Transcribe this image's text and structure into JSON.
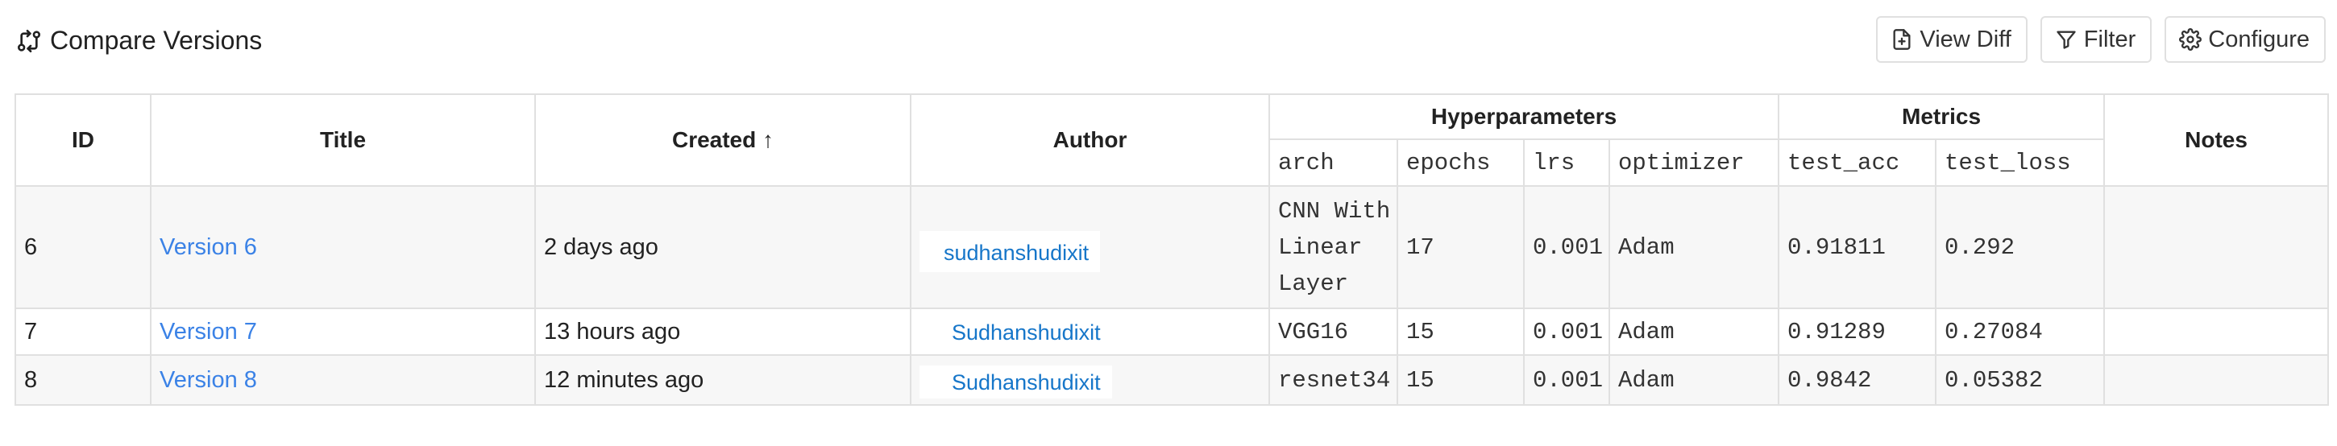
{
  "header": {
    "title": "Compare Versions",
    "title_icon": "compare-icon",
    "actions": {
      "view_diff": "View Diff",
      "filter": "Filter",
      "configure": "Configure"
    }
  },
  "table": {
    "columns": {
      "id": "ID",
      "title": "Title",
      "created": "Created",
      "author": "Author",
      "hyperparameters": "Hyperparameters",
      "metrics": "Metrics",
      "notes": "Notes"
    },
    "sort_indicator": "↑",
    "hyper_columns": [
      "arch",
      "epochs",
      "lrs",
      "optimizer"
    ],
    "metric_columns": [
      "test_acc",
      "test_loss"
    ],
    "rows": [
      {
        "id": "6",
        "title": "Version 6",
        "created": "2 days ago",
        "author": "sudhanshudixit",
        "arch_lines": [
          "CNN With",
          "Linear",
          "Layer"
        ],
        "epochs": "17",
        "lrs": "0.001",
        "optimizer": "Adam",
        "test_acc": "0.91811",
        "test_loss": "0.292",
        "notes": ""
      },
      {
        "id": "7",
        "title": "Version 7",
        "created": "13 hours ago",
        "author": "Sudhanshudixit",
        "arch_lines": [
          "VGG16"
        ],
        "epochs": "15",
        "lrs": "0.001",
        "optimizer": "Adam",
        "test_acc": "0.91289",
        "test_loss": "0.27084",
        "notes": ""
      },
      {
        "id": "8",
        "title": "Version 8",
        "created": "12 minutes ago",
        "author": "Sudhanshudixit",
        "arch_lines": [
          "resnet34"
        ],
        "epochs": "15",
        "lrs": "0.001",
        "optimizer": "Adam",
        "test_acc": "0.9842",
        "test_loss": "0.05382",
        "notes": ""
      }
    ]
  },
  "colors": {
    "link": "#3b82e6",
    "author_link": "#1676c9",
    "border": "#e0e0e0",
    "row_alt_background": "#f7f7f7"
  }
}
